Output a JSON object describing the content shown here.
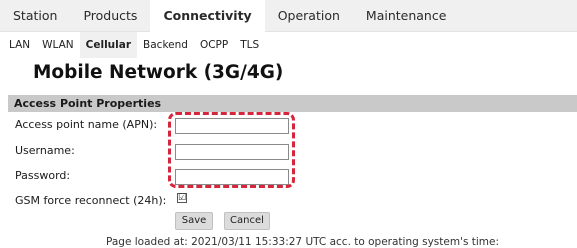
{
  "main_tabs": [
    "Station",
    "Products",
    "Connectivity",
    "Operation",
    "Maintenance"
  ],
  "active_main_tab": "Connectivity",
  "sub_tabs": [
    "LAN",
    "WLAN",
    "Cellular",
    "Backend",
    "OCPP",
    "TLS"
  ],
  "active_sub_tab": "Cellular",
  "page_title": "Mobile Network (3G/4G)",
  "section_title": "Access Point Properties",
  "form": {
    "apn_label": "Access point name (APN):",
    "apn_value": "",
    "username_label": "Username:",
    "username_value": "",
    "password_label": "Password:",
    "password_value": "",
    "gsm_label": "GSM force reconnect (24h):",
    "gsm_checked": true,
    "checkbox_glyph": "☑"
  },
  "buttons": {
    "save": "Save",
    "cancel": "Cancel"
  },
  "footer_text": "Page loaded at: 2021/03/11 15:33:27 UTC acc. to operating system's time:",
  "colors": {
    "highlight": "#d6263c",
    "section_bg": "#c9c9c9",
    "nav_bg": "#f0f0f0"
  }
}
